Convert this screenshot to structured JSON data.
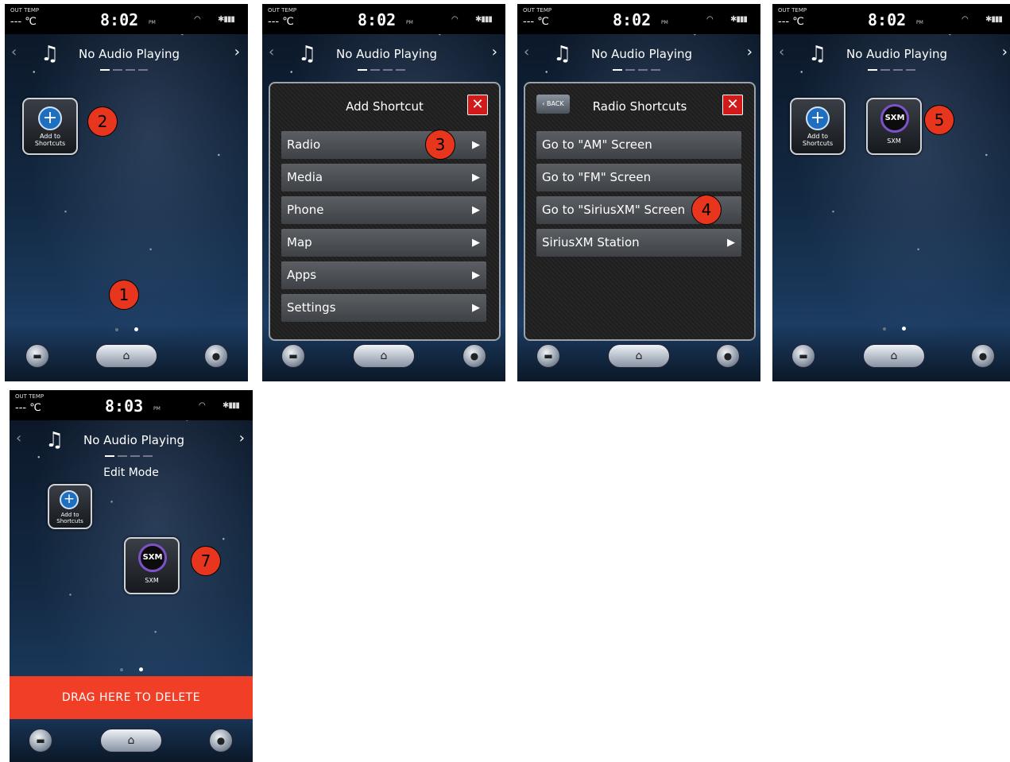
{
  "status": {
    "out_temp_label": "OUT TEMP",
    "temp_value": "--- ℃",
    "ampm": "PM",
    "wifi_icon": "wifi-icon",
    "signal_icon": "bluetooth-signal-battery-icon"
  },
  "audio": {
    "text": "No Audio Playing",
    "prev_icon": "‹",
    "next_icon": "›",
    "music_icon": "♫"
  },
  "shortcut": {
    "add_label_line1": "Add to",
    "add_label_line2": "Shortcuts",
    "plus_symbol": "+",
    "sxm_logo": "SXM",
    "sxm_label": "SXM"
  },
  "screens": [
    {
      "clock": "8:02",
      "badges": [
        "2",
        "1"
      ]
    },
    {
      "clock": "8:02",
      "panel_title": "Add Shortcut",
      "menu": [
        "Radio",
        "Media",
        "Phone",
        "Map",
        "Apps",
        "Settings"
      ],
      "badge": "3"
    },
    {
      "clock": "8:02",
      "panel_title": "Radio Shortcuts",
      "back_label": "BACK",
      "menu": [
        "Go to \"AM\" Screen",
        "Go to \"FM\" Screen",
        "Go to \"SiriusXM\" Screen",
        "SiriusXM Station"
      ],
      "badge": "4"
    },
    {
      "clock": "8:02",
      "badge": "5"
    },
    {
      "clock": "8:03",
      "edit_mode": "Edit Mode",
      "delete_text": "DRAG HERE TO DELETE",
      "badge": "7"
    }
  ],
  "close_symbol": "✕",
  "submenu_arrow": "▶",
  "bottom_nav": {
    "car_icon": "car-icon",
    "home_icon": "home-icon",
    "profile_icon": "profile-icon"
  },
  "colors": {
    "badge": "#e8361e",
    "delete_bar": "#f03e27",
    "close_button": "#d11a1a",
    "sxm_ring": "#7d52c9",
    "add_circle": "#1f6fc1"
  }
}
